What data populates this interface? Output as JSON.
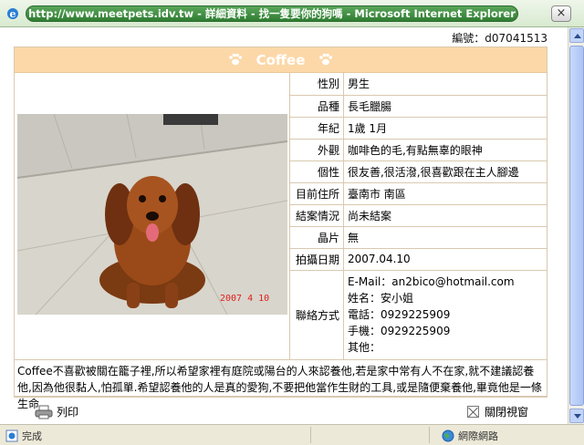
{
  "window": {
    "title": "http://www.meetpets.idv.tw - 詳細資料 - 找一隻要你的狗嗎 - Microsoft Internet Explorer",
    "close_label": "×"
  },
  "pet": {
    "number": "編號：d07041513",
    "name": "Coffee",
    "photo_date_stamp": "2007  4  10",
    "fields": [
      {
        "label": "性別",
        "value": "男生"
      },
      {
        "label": "品種",
        "value": "長毛臘腸"
      },
      {
        "label": "年紀",
        "value": "1歲 1月"
      },
      {
        "label": "外觀",
        "value": "咖啡色的毛,有點無辜的眼神"
      },
      {
        "label": "個性",
        "value": "很友善,很活潑,很喜歡跟在主人腳邊"
      },
      {
        "label": "目前住所",
        "value": "臺南市 南區"
      },
      {
        "label": "結案情況",
        "value": "尚未結案"
      },
      {
        "label": "晶片",
        "value": "無"
      },
      {
        "label": "拍攝日期",
        "value": "2007.04.10"
      }
    ],
    "contact": {
      "label": "聯絡方式",
      "email": "E-Mail：an2bico@hotmail.com",
      "name": "姓名：安小姐",
      "phone": "電話：0929225909",
      "mobile": "手機：0929225909",
      "other": "其他："
    },
    "description": "Coffee不喜歡被關在籠子裡,所以希望家裡有庭院或陽台的人來認養他,若是家中常有人不在家,就不建議認養他,因為他很黏人,怕孤單.希望認養他的人是真的愛狗,不要把他當作生財的工具,或是隨便棄養他,畢竟他是一條生命."
  },
  "actions": {
    "print_label": "列印",
    "close_window_label": "關閉視窗"
  },
  "status": {
    "left_text": "完成",
    "right_text": "網際網路"
  },
  "colors": {
    "header_bg": "#fcd8a8",
    "title_pill": "#2f7d32",
    "border": "#d9c9b0"
  }
}
